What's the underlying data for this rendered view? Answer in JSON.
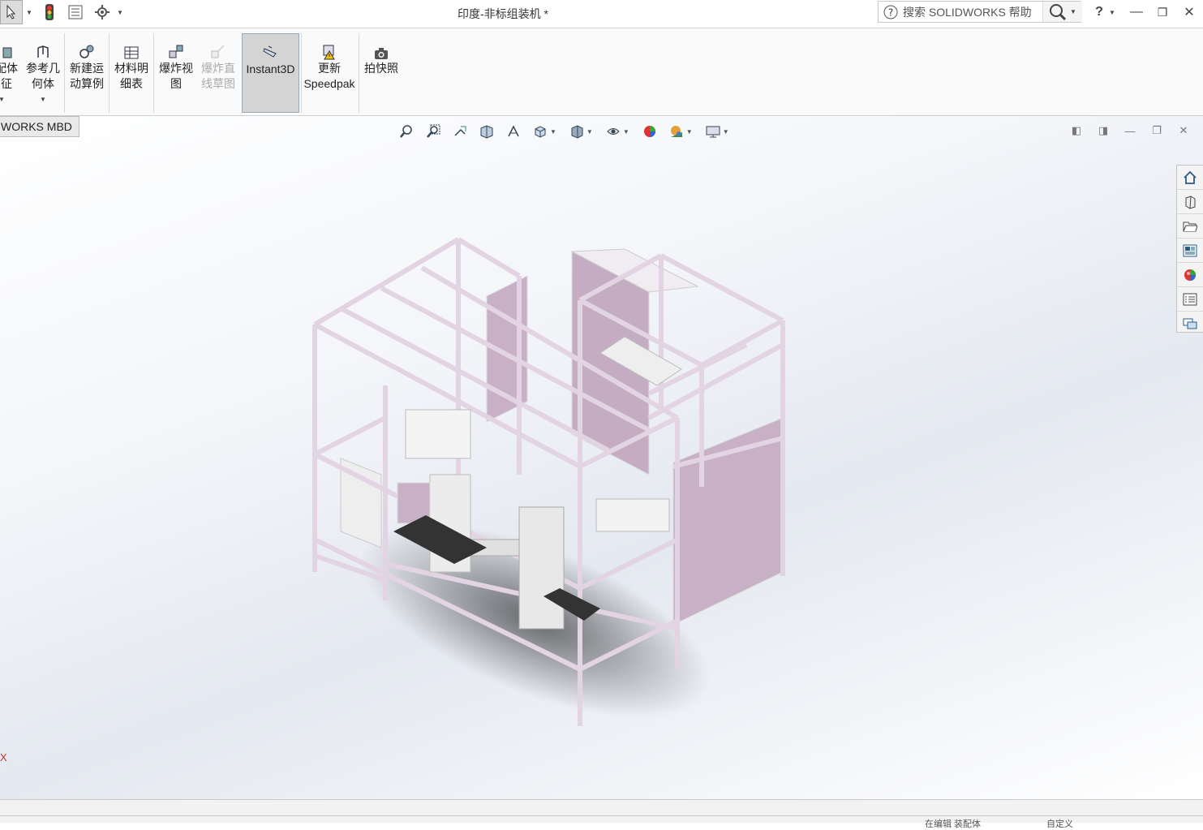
{
  "app": {
    "title": "印度-非标组装机 *"
  },
  "search": {
    "placeholder": "搜索 SOLIDWORKS 帮助"
  },
  "ribbon": {
    "items": [
      {
        "label": "配体\n征"
      },
      {
        "label": "参考几\n何体"
      },
      {
        "label": "新建运\n动算例"
      },
      {
        "label": "材料明\n细表"
      },
      {
        "label": "爆炸视\n图"
      },
      {
        "label": "爆炸直\n线草图"
      },
      {
        "label": "Instant3D"
      },
      {
        "label": "更新\nSpeedpak"
      },
      {
        "label": "拍快照"
      }
    ]
  },
  "tabs": {
    "active": "WORKS MBD"
  },
  "triad": {
    "x_label": "X"
  },
  "status": {
    "left": "",
    "mid": "在编辑 装配体",
    "right": "自定义"
  },
  "colors": {
    "frame": "#e2d4e2",
    "panel": "#c8b0c6",
    "accent": "#4a7db5"
  }
}
